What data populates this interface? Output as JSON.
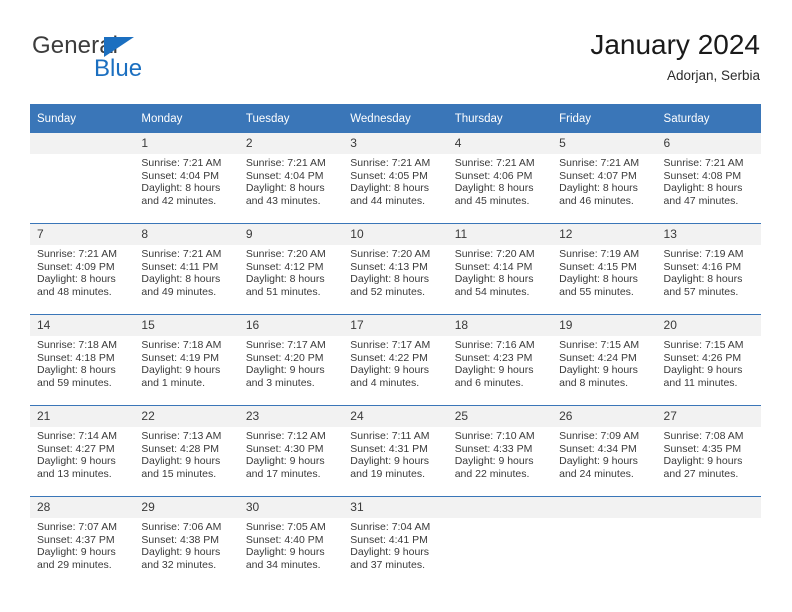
{
  "brand": {
    "name_top": "General",
    "name_bottom": "Blue",
    "accent_color": "#1b6fc0"
  },
  "header": {
    "title": "January 2024",
    "subtitle": "Adorjan, Serbia"
  },
  "calendar": {
    "header_color": "#3a76b8",
    "daynum_bg": "#f2f2f2",
    "weekday_headers": [
      "Sunday",
      "Monday",
      "Tuesday",
      "Wednesday",
      "Thursday",
      "Friday",
      "Saturday"
    ],
    "weeks": [
      [
        {
          "day": "",
          "lines": []
        },
        {
          "day": "1",
          "lines": [
            "Sunrise: 7:21 AM",
            "Sunset: 4:04 PM",
            "Daylight: 8 hours",
            "and 42 minutes."
          ]
        },
        {
          "day": "2",
          "lines": [
            "Sunrise: 7:21 AM",
            "Sunset: 4:04 PM",
            "Daylight: 8 hours",
            "and 43 minutes."
          ]
        },
        {
          "day": "3",
          "lines": [
            "Sunrise: 7:21 AM",
            "Sunset: 4:05 PM",
            "Daylight: 8 hours",
            "and 44 minutes."
          ]
        },
        {
          "day": "4",
          "lines": [
            "Sunrise: 7:21 AM",
            "Sunset: 4:06 PM",
            "Daylight: 8 hours",
            "and 45 minutes."
          ]
        },
        {
          "day": "5",
          "lines": [
            "Sunrise: 7:21 AM",
            "Sunset: 4:07 PM",
            "Daylight: 8 hours",
            "and 46 minutes."
          ]
        },
        {
          "day": "6",
          "lines": [
            "Sunrise: 7:21 AM",
            "Sunset: 4:08 PM",
            "Daylight: 8 hours",
            "and 47 minutes."
          ]
        }
      ],
      [
        {
          "day": "7",
          "lines": [
            "Sunrise: 7:21 AM",
            "Sunset: 4:09 PM",
            "Daylight: 8 hours",
            "and 48 minutes."
          ]
        },
        {
          "day": "8",
          "lines": [
            "Sunrise: 7:21 AM",
            "Sunset: 4:11 PM",
            "Daylight: 8 hours",
            "and 49 minutes."
          ]
        },
        {
          "day": "9",
          "lines": [
            "Sunrise: 7:20 AM",
            "Sunset: 4:12 PM",
            "Daylight: 8 hours",
            "and 51 minutes."
          ]
        },
        {
          "day": "10",
          "lines": [
            "Sunrise: 7:20 AM",
            "Sunset: 4:13 PM",
            "Daylight: 8 hours",
            "and 52 minutes."
          ]
        },
        {
          "day": "11",
          "lines": [
            "Sunrise: 7:20 AM",
            "Sunset: 4:14 PM",
            "Daylight: 8 hours",
            "and 54 minutes."
          ]
        },
        {
          "day": "12",
          "lines": [
            "Sunrise: 7:19 AM",
            "Sunset: 4:15 PM",
            "Daylight: 8 hours",
            "and 55 minutes."
          ]
        },
        {
          "day": "13",
          "lines": [
            "Sunrise: 7:19 AM",
            "Sunset: 4:16 PM",
            "Daylight: 8 hours",
            "and 57 minutes."
          ]
        }
      ],
      [
        {
          "day": "14",
          "lines": [
            "Sunrise: 7:18 AM",
            "Sunset: 4:18 PM",
            "Daylight: 8 hours",
            "and 59 minutes."
          ]
        },
        {
          "day": "15",
          "lines": [
            "Sunrise: 7:18 AM",
            "Sunset: 4:19 PM",
            "Daylight: 9 hours",
            "and 1 minute."
          ]
        },
        {
          "day": "16",
          "lines": [
            "Sunrise: 7:17 AM",
            "Sunset: 4:20 PM",
            "Daylight: 9 hours",
            "and 3 minutes."
          ]
        },
        {
          "day": "17",
          "lines": [
            "Sunrise: 7:17 AM",
            "Sunset: 4:22 PM",
            "Daylight: 9 hours",
            "and 4 minutes."
          ]
        },
        {
          "day": "18",
          "lines": [
            "Sunrise: 7:16 AM",
            "Sunset: 4:23 PM",
            "Daylight: 9 hours",
            "and 6 minutes."
          ]
        },
        {
          "day": "19",
          "lines": [
            "Sunrise: 7:15 AM",
            "Sunset: 4:24 PM",
            "Daylight: 9 hours",
            "and 8 minutes."
          ]
        },
        {
          "day": "20",
          "lines": [
            "Sunrise: 7:15 AM",
            "Sunset: 4:26 PM",
            "Daylight: 9 hours",
            "and 11 minutes."
          ]
        }
      ],
      [
        {
          "day": "21",
          "lines": [
            "Sunrise: 7:14 AM",
            "Sunset: 4:27 PM",
            "Daylight: 9 hours",
            "and 13 minutes."
          ]
        },
        {
          "day": "22",
          "lines": [
            "Sunrise: 7:13 AM",
            "Sunset: 4:28 PM",
            "Daylight: 9 hours",
            "and 15 minutes."
          ]
        },
        {
          "day": "23",
          "lines": [
            "Sunrise: 7:12 AM",
            "Sunset: 4:30 PM",
            "Daylight: 9 hours",
            "and 17 minutes."
          ]
        },
        {
          "day": "24",
          "lines": [
            "Sunrise: 7:11 AM",
            "Sunset: 4:31 PM",
            "Daylight: 9 hours",
            "and 19 minutes."
          ]
        },
        {
          "day": "25",
          "lines": [
            "Sunrise: 7:10 AM",
            "Sunset: 4:33 PM",
            "Daylight: 9 hours",
            "and 22 minutes."
          ]
        },
        {
          "day": "26",
          "lines": [
            "Sunrise: 7:09 AM",
            "Sunset: 4:34 PM",
            "Daylight: 9 hours",
            "and 24 minutes."
          ]
        },
        {
          "day": "27",
          "lines": [
            "Sunrise: 7:08 AM",
            "Sunset: 4:35 PM",
            "Daylight: 9 hours",
            "and 27 minutes."
          ]
        }
      ],
      [
        {
          "day": "28",
          "lines": [
            "Sunrise: 7:07 AM",
            "Sunset: 4:37 PM",
            "Daylight: 9 hours",
            "and 29 minutes."
          ]
        },
        {
          "day": "29",
          "lines": [
            "Sunrise: 7:06 AM",
            "Sunset: 4:38 PM",
            "Daylight: 9 hours",
            "and 32 minutes."
          ]
        },
        {
          "day": "30",
          "lines": [
            "Sunrise: 7:05 AM",
            "Sunset: 4:40 PM",
            "Daylight: 9 hours",
            "and 34 minutes."
          ]
        },
        {
          "day": "31",
          "lines": [
            "Sunrise: 7:04 AM",
            "Sunset: 4:41 PM",
            "Daylight: 9 hours",
            "and 37 minutes."
          ]
        },
        {
          "day": "",
          "lines": []
        },
        {
          "day": "",
          "lines": []
        },
        {
          "day": "",
          "lines": []
        }
      ]
    ]
  }
}
